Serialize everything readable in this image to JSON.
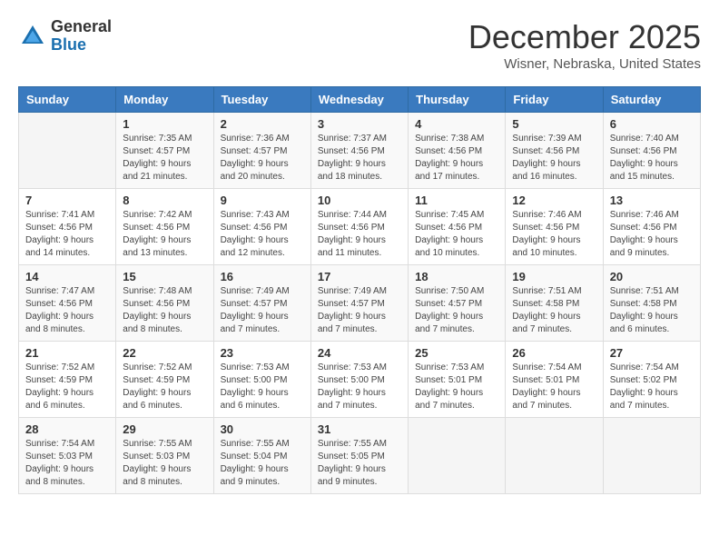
{
  "header": {
    "logo_general": "General",
    "logo_blue": "Blue",
    "month_title": "December 2025",
    "location": "Wisner, Nebraska, United States"
  },
  "days_of_week": [
    "Sunday",
    "Monday",
    "Tuesday",
    "Wednesday",
    "Thursday",
    "Friday",
    "Saturday"
  ],
  "weeks": [
    [
      {
        "day": "",
        "sunrise": "",
        "sunset": "",
        "daylight": ""
      },
      {
        "day": "1",
        "sunrise": "Sunrise: 7:35 AM",
        "sunset": "Sunset: 4:57 PM",
        "daylight": "Daylight: 9 hours and 21 minutes."
      },
      {
        "day": "2",
        "sunrise": "Sunrise: 7:36 AM",
        "sunset": "Sunset: 4:57 PM",
        "daylight": "Daylight: 9 hours and 20 minutes."
      },
      {
        "day": "3",
        "sunrise": "Sunrise: 7:37 AM",
        "sunset": "Sunset: 4:56 PM",
        "daylight": "Daylight: 9 hours and 18 minutes."
      },
      {
        "day": "4",
        "sunrise": "Sunrise: 7:38 AM",
        "sunset": "Sunset: 4:56 PM",
        "daylight": "Daylight: 9 hours and 17 minutes."
      },
      {
        "day": "5",
        "sunrise": "Sunrise: 7:39 AM",
        "sunset": "Sunset: 4:56 PM",
        "daylight": "Daylight: 9 hours and 16 minutes."
      },
      {
        "day": "6",
        "sunrise": "Sunrise: 7:40 AM",
        "sunset": "Sunset: 4:56 PM",
        "daylight": "Daylight: 9 hours and 15 minutes."
      }
    ],
    [
      {
        "day": "7",
        "sunrise": "Sunrise: 7:41 AM",
        "sunset": "Sunset: 4:56 PM",
        "daylight": "Daylight: 9 hours and 14 minutes."
      },
      {
        "day": "8",
        "sunrise": "Sunrise: 7:42 AM",
        "sunset": "Sunset: 4:56 PM",
        "daylight": "Daylight: 9 hours and 13 minutes."
      },
      {
        "day": "9",
        "sunrise": "Sunrise: 7:43 AM",
        "sunset": "Sunset: 4:56 PM",
        "daylight": "Daylight: 9 hours and 12 minutes."
      },
      {
        "day": "10",
        "sunrise": "Sunrise: 7:44 AM",
        "sunset": "Sunset: 4:56 PM",
        "daylight": "Daylight: 9 hours and 11 minutes."
      },
      {
        "day": "11",
        "sunrise": "Sunrise: 7:45 AM",
        "sunset": "Sunset: 4:56 PM",
        "daylight": "Daylight: 9 hours and 10 minutes."
      },
      {
        "day": "12",
        "sunrise": "Sunrise: 7:46 AM",
        "sunset": "Sunset: 4:56 PM",
        "daylight": "Daylight: 9 hours and 10 minutes."
      },
      {
        "day": "13",
        "sunrise": "Sunrise: 7:46 AM",
        "sunset": "Sunset: 4:56 PM",
        "daylight": "Daylight: 9 hours and 9 minutes."
      }
    ],
    [
      {
        "day": "14",
        "sunrise": "Sunrise: 7:47 AM",
        "sunset": "Sunset: 4:56 PM",
        "daylight": "Daylight: 9 hours and 8 minutes."
      },
      {
        "day": "15",
        "sunrise": "Sunrise: 7:48 AM",
        "sunset": "Sunset: 4:56 PM",
        "daylight": "Daylight: 9 hours and 8 minutes."
      },
      {
        "day": "16",
        "sunrise": "Sunrise: 7:49 AM",
        "sunset": "Sunset: 4:57 PM",
        "daylight": "Daylight: 9 hours and 7 minutes."
      },
      {
        "day": "17",
        "sunrise": "Sunrise: 7:49 AM",
        "sunset": "Sunset: 4:57 PM",
        "daylight": "Daylight: 9 hours and 7 minutes."
      },
      {
        "day": "18",
        "sunrise": "Sunrise: 7:50 AM",
        "sunset": "Sunset: 4:57 PM",
        "daylight": "Daylight: 9 hours and 7 minutes."
      },
      {
        "day": "19",
        "sunrise": "Sunrise: 7:51 AM",
        "sunset": "Sunset: 4:58 PM",
        "daylight": "Daylight: 9 hours and 7 minutes."
      },
      {
        "day": "20",
        "sunrise": "Sunrise: 7:51 AM",
        "sunset": "Sunset: 4:58 PM",
        "daylight": "Daylight: 9 hours and 6 minutes."
      }
    ],
    [
      {
        "day": "21",
        "sunrise": "Sunrise: 7:52 AM",
        "sunset": "Sunset: 4:59 PM",
        "daylight": "Daylight: 9 hours and 6 minutes."
      },
      {
        "day": "22",
        "sunrise": "Sunrise: 7:52 AM",
        "sunset": "Sunset: 4:59 PM",
        "daylight": "Daylight: 9 hours and 6 minutes."
      },
      {
        "day": "23",
        "sunrise": "Sunrise: 7:53 AM",
        "sunset": "Sunset: 5:00 PM",
        "daylight": "Daylight: 9 hours and 6 minutes."
      },
      {
        "day": "24",
        "sunrise": "Sunrise: 7:53 AM",
        "sunset": "Sunset: 5:00 PM",
        "daylight": "Daylight: 9 hours and 7 minutes."
      },
      {
        "day": "25",
        "sunrise": "Sunrise: 7:53 AM",
        "sunset": "Sunset: 5:01 PM",
        "daylight": "Daylight: 9 hours and 7 minutes."
      },
      {
        "day": "26",
        "sunrise": "Sunrise: 7:54 AM",
        "sunset": "Sunset: 5:01 PM",
        "daylight": "Daylight: 9 hours and 7 minutes."
      },
      {
        "day": "27",
        "sunrise": "Sunrise: 7:54 AM",
        "sunset": "Sunset: 5:02 PM",
        "daylight": "Daylight: 9 hours and 7 minutes."
      }
    ],
    [
      {
        "day": "28",
        "sunrise": "Sunrise: 7:54 AM",
        "sunset": "Sunset: 5:03 PM",
        "daylight": "Daylight: 9 hours and 8 minutes."
      },
      {
        "day": "29",
        "sunrise": "Sunrise: 7:55 AM",
        "sunset": "Sunset: 5:03 PM",
        "daylight": "Daylight: 9 hours and 8 minutes."
      },
      {
        "day": "30",
        "sunrise": "Sunrise: 7:55 AM",
        "sunset": "Sunset: 5:04 PM",
        "daylight": "Daylight: 9 hours and 9 minutes."
      },
      {
        "day": "31",
        "sunrise": "Sunrise: 7:55 AM",
        "sunset": "Sunset: 5:05 PM",
        "daylight": "Daylight: 9 hours and 9 minutes."
      },
      {
        "day": "",
        "sunrise": "",
        "sunset": "",
        "daylight": ""
      },
      {
        "day": "",
        "sunrise": "",
        "sunset": "",
        "daylight": ""
      },
      {
        "day": "",
        "sunrise": "",
        "sunset": "",
        "daylight": ""
      }
    ]
  ]
}
